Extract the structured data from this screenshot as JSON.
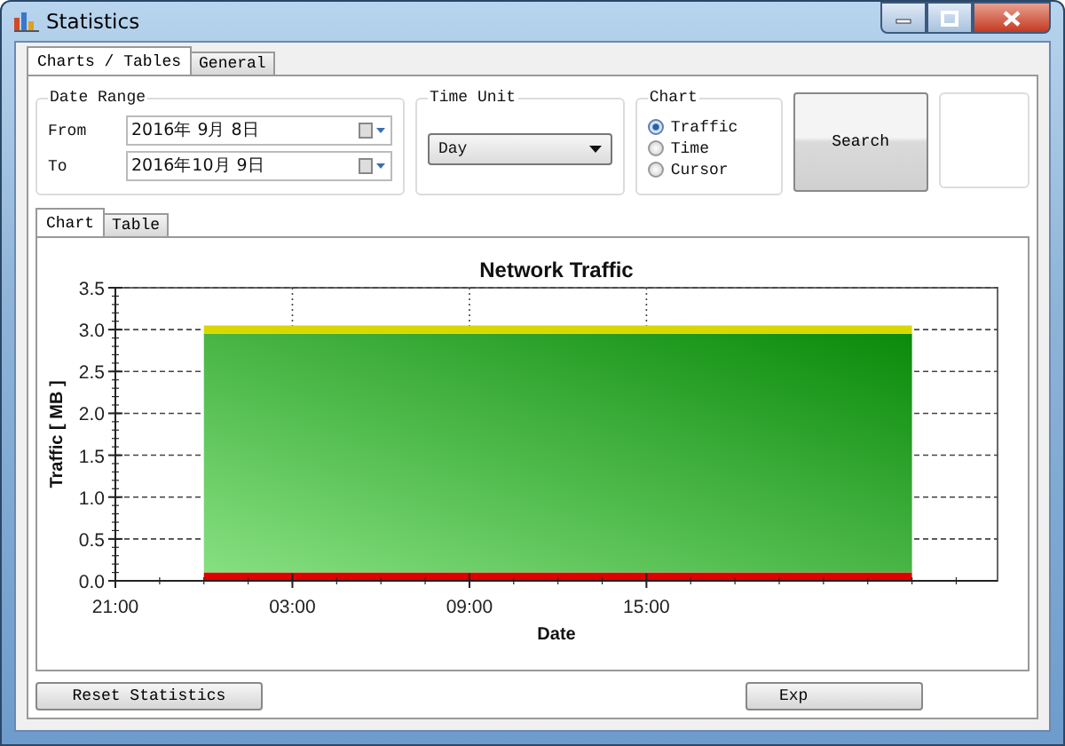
{
  "window": {
    "title": "Statistics"
  },
  "tabs": [
    {
      "label": "Charts / Tables",
      "selected": true
    },
    {
      "label": "General",
      "selected": false
    }
  ],
  "date_range": {
    "title": "Date Range",
    "fields": [
      {
        "label": "From",
        "value": "2016年 9月 8日"
      },
      {
        "label": "To",
        "value": "2016年10月 9日"
      }
    ]
  },
  "time_unit": {
    "title": "Time Unit",
    "value": "Day"
  },
  "chart_type": {
    "title": "Chart",
    "options": [
      {
        "label": "Traffic",
        "selected": true
      },
      {
        "label": "Time",
        "selected": false
      },
      {
        "label": "Cursor",
        "selected": false
      }
    ]
  },
  "search_button": "Search",
  "view_tabs": [
    {
      "label": "Chart",
      "selected": true
    },
    {
      "label": "Table",
      "selected": false
    }
  ],
  "chart": {
    "chart_data": {
      "type": "area",
      "title": "Network Traffic",
      "xlabel": "Date",
      "ylabel": "Traffic [ MB ]",
      "stacked": true,
      "grid": true,
      "ylim": [
        0,
        3.5
      ],
      "categories": [
        "21:00",
        null,
        null,
        null,
        null,
        null,
        "03:00",
        null,
        null,
        null,
        null,
        null,
        "09:00",
        null,
        null,
        null,
        null,
        null,
        "15:00",
        null,
        null,
        null,
        null,
        null,
        null,
        null,
        null,
        null,
        null,
        null
      ],
      "yticks": [
        {
          "value": 0,
          "label": "0.0"
        },
        {
          "value": 0.5,
          "label": "0.5"
        },
        {
          "value": 1,
          "label": "1.0"
        },
        {
          "value": 1.5,
          "label": "1.5"
        },
        {
          "value": 2,
          "label": "2.0"
        },
        {
          "value": 2.5,
          "label": "2.5"
        },
        {
          "value": 3,
          "label": "3.0"
        },
        {
          "value": 3.5,
          "label": "3.5"
        }
      ],
      "series": [
        {
          "color": "#e00000",
          "values": [
            null,
            null,
            null,
            0.1,
            0.1,
            0.1,
            0.1,
            0.1,
            0.1,
            0.1,
            0.1,
            0.1,
            0.1,
            0.1,
            0.1,
            0.1,
            0.1,
            0.1,
            0.1,
            0.1,
            0.1,
            0.1,
            0.1,
            0.1,
            0.1,
            0.1,
            0.1,
            0.1,
            null,
            null
          ]
        },
        {
          "color": "#2aa02a",
          "values": [
            null,
            null,
            null,
            2.85,
            2.85,
            2.85,
            2.85,
            2.85,
            2.85,
            2.85,
            2.85,
            2.85,
            2.85,
            2.85,
            2.85,
            2.85,
            2.85,
            2.85,
            2.85,
            2.85,
            2.85,
            2.85,
            2.85,
            2.85,
            2.85,
            2.85,
            2.85,
            2.85,
            null,
            null
          ]
        },
        {
          "color": "#d8d800",
          "values": [
            null,
            null,
            null,
            0.1,
            0.1,
            0.1,
            0.1,
            0.1,
            0.1,
            0.1,
            0.1,
            0.1,
            0.1,
            0.1,
            0.1,
            0.1,
            0.1,
            0.1,
            0.1,
            0.1,
            0.1,
            0.1,
            0.1,
            0.1,
            0.1,
            0.1,
            0.1,
            0.1,
            null,
            null
          ]
        }
      ]
    }
  },
  "buttons": [
    "Reset Statistics",
    "Exp"
  ]
}
